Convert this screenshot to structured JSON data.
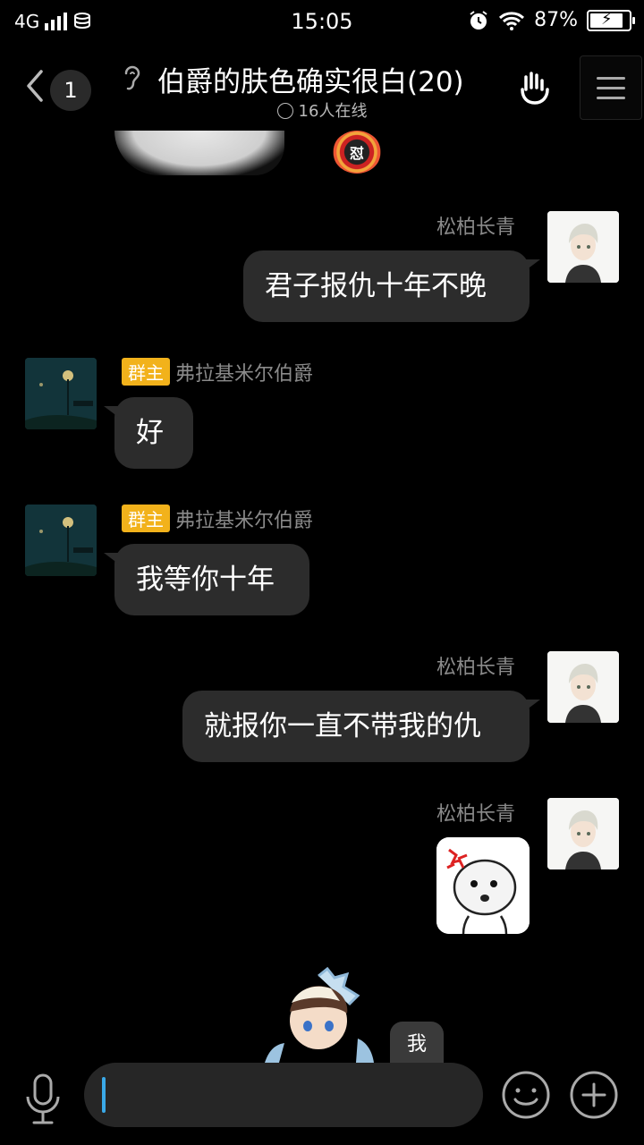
{
  "status_bar": {
    "network": "4G",
    "time": "15:05",
    "battery": "87%"
  },
  "header": {
    "unread_count": "1",
    "title": "伯爵的肤色确实很白(20)",
    "online_status": "16人在线"
  },
  "top_sticker_badge": "怼",
  "messages": [
    {
      "side": "right",
      "sender": "松柏长青",
      "text": "君子报仇十年不晚"
    },
    {
      "side": "left",
      "sender": "弗拉基米尔伯爵",
      "tag": "群主",
      "text": "好"
    },
    {
      "side": "left",
      "sender": "弗拉基米尔伯爵",
      "tag": "群主",
      "text": "我等你十年"
    },
    {
      "side": "right",
      "sender": "松柏长青",
      "text": "就报你一直不带我的仇"
    },
    {
      "side": "right",
      "sender": "松柏长青",
      "type": "sticker"
    }
  ],
  "bottom_mini_bubble": "我",
  "input": {
    "value": "",
    "icons": [
      "mic-icon",
      "emoji-icon",
      "plus-icon"
    ]
  },
  "colors": {
    "background": "#000000",
    "bubble": "#2c2c2c",
    "owner_tag": "#f2b21b",
    "cursor": "#3aa9e8"
  }
}
